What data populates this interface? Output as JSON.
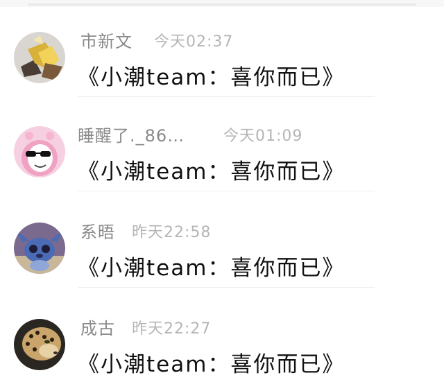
{
  "comments": [
    {
      "author": "市新文",
      "time": "今天02:37",
      "text": "《小潮team：喜你而已》",
      "avatar_icon": "gold-abstract-icon"
    },
    {
      "author": "睡醒了._86…",
      "time": "今天01:09",
      "text": "《小潮team：喜你而已》",
      "avatar_icon": "pink-sunglasses-character-icon"
    },
    {
      "author": "系晤",
      "time": "昨天22:58",
      "text": "《小潮team：喜你而已》",
      "avatar_icon": "stitch-character-icon"
    },
    {
      "author": "成古",
      "time": "昨天22:27",
      "text": "《小潮team：喜你而已》",
      "avatar_icon": "leopard-icon"
    }
  ]
}
